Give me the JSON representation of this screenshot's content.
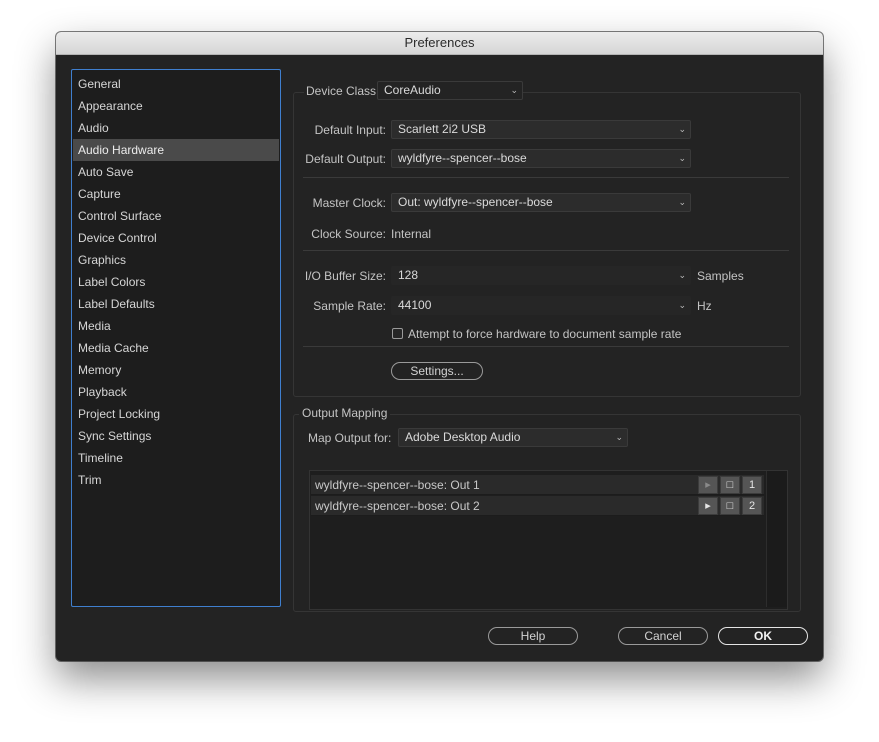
{
  "window": {
    "title": "Preferences"
  },
  "sidebar": {
    "items": [
      {
        "label": "General"
      },
      {
        "label": "Appearance"
      },
      {
        "label": "Audio"
      },
      {
        "label": "Audio Hardware"
      },
      {
        "label": "Auto Save"
      },
      {
        "label": "Capture"
      },
      {
        "label": "Control Surface"
      },
      {
        "label": "Device Control"
      },
      {
        "label": "Graphics"
      },
      {
        "label": "Label Colors"
      },
      {
        "label": "Label Defaults"
      },
      {
        "label": "Media"
      },
      {
        "label": "Media Cache"
      },
      {
        "label": "Memory"
      },
      {
        "label": "Playback"
      },
      {
        "label": "Project Locking"
      },
      {
        "label": "Sync Settings"
      },
      {
        "label": "Timeline"
      },
      {
        "label": "Trim"
      }
    ],
    "selected": "Audio Hardware"
  },
  "hardware": {
    "device_class_label": "Device Class:",
    "device_class_value": "CoreAudio",
    "default_input_label": "Default Input:",
    "default_input_value": "Scarlett 2i2 USB",
    "default_output_label": "Default Output:",
    "default_output_value": "wyldfyre--spencer--bose",
    "master_clock_label": "Master Clock:",
    "master_clock_value": "Out: wyldfyre--spencer--bose",
    "clock_source_label": "Clock Source:",
    "clock_source_value": "Internal",
    "buffer_label": "I/O Buffer Size:",
    "buffer_value": "128",
    "buffer_unit": "Samples",
    "sample_rate_label": "Sample Rate:",
    "sample_rate_value": "44100",
    "sample_rate_unit": "Hz",
    "force_rate_label": "Attempt to force hardware to document sample rate",
    "force_rate_checked": false,
    "settings_button": "Settings..."
  },
  "output_mapping": {
    "section_title": "Output Mapping",
    "map_output_label": "Map Output for:",
    "map_output_value": "Adobe Desktop Audio",
    "rows": [
      {
        "name": "wyldfyre--spencer--bose: Out 1",
        "channel": "1"
      },
      {
        "name": "wyldfyre--spencer--bose: Out 2",
        "channel": "2"
      }
    ]
  },
  "footer": {
    "help": "Help",
    "cancel": "Cancel",
    "ok": "OK"
  },
  "colors": {
    "window_bg": "#232323",
    "selection_bg": "#4a4a4a",
    "focus_border": "#3f7fcf"
  }
}
